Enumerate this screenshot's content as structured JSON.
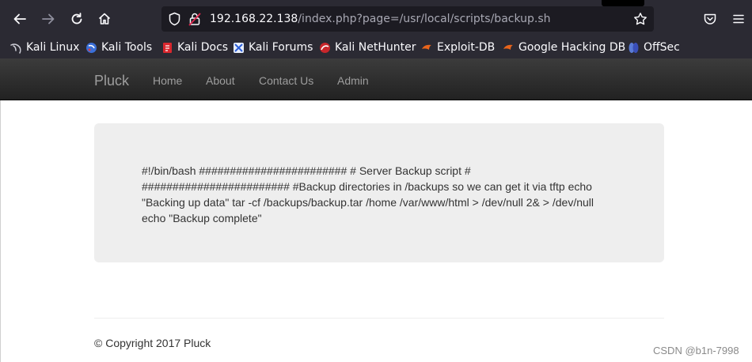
{
  "browser": {
    "url_host": "192.168.22.138",
    "url_path": "/index.php?page=/usr/local/scripts/backup.sh",
    "icons": [
      "back-icon",
      "forward-icon",
      "reload-icon",
      "home-icon",
      "shield-icon",
      "lock-icon",
      "star-icon",
      "pocket-icon",
      "menu-icon"
    ],
    "bookmarks": [
      {
        "label": "Kali Linux",
        "icon": "kali-dragon-icon"
      },
      {
        "label": "Kali Tools",
        "icon": "kali-tools-icon"
      },
      {
        "label": "Kali Docs",
        "icon": "kali-docs-icon"
      },
      {
        "label": "Kali Forums",
        "icon": "kali-forums-icon"
      },
      {
        "label": "Kali NetHunter",
        "icon": "nethunter-icon"
      },
      {
        "label": "Exploit-DB",
        "icon": "exploitdb-icon"
      },
      {
        "label": "Google Hacking DB",
        "icon": "ghdb-icon"
      },
      {
        "label": "OffSec",
        "icon": "offsec-icon"
      }
    ]
  },
  "site": {
    "brand": "Pluck",
    "nav": [
      "Home",
      "About",
      "Contact Us",
      "Admin"
    ]
  },
  "content": {
    "lines": [
      "#!/bin/bash ######################## # Server Backup script #",
      "######################## #Backup directories in /backups so we can get it via tftp echo",
      "\"Backing up data\" tar -cf /backups/backup.tar /home /var/www/html > /dev/null 2& > /dev/null",
      "echo \"Backup complete\""
    ]
  },
  "footer": {
    "copyright": "© Copyright 2017 Pluck"
  },
  "watermark": "CSDN @b1n-7998",
  "colors": {
    "chrome": "#2b2a33",
    "urlbar": "#1c1b22",
    "navbar": "#222222",
    "navlink": "#9d9d9d",
    "well": "#eeeeee",
    "text": "#333333"
  }
}
